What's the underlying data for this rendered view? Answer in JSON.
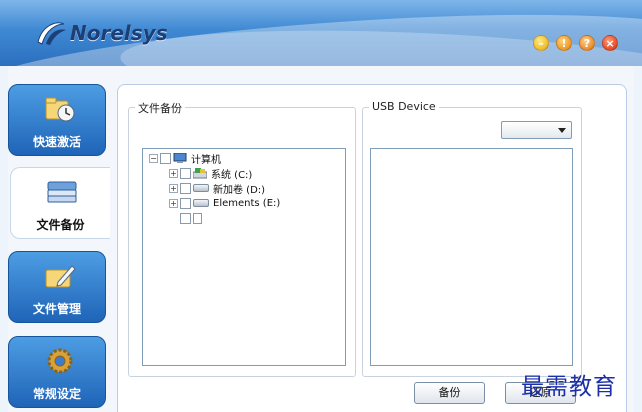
{
  "app": {
    "logo_text": "Norelsys"
  },
  "header_buttons": [
    {
      "name": "minimize",
      "glyph": "–"
    },
    {
      "name": "warning",
      "glyph": "!"
    },
    {
      "name": "help",
      "glyph": "?"
    },
    {
      "name": "close",
      "glyph": "×"
    }
  ],
  "sidebar": {
    "items": [
      {
        "label": "快速激活",
        "icon": "quick-activate-icon",
        "active": false
      },
      {
        "label": "文件备份",
        "icon": "file-backup-icon",
        "active": true
      },
      {
        "label": "文件管理",
        "icon": "file-manage-icon",
        "active": false
      },
      {
        "label": "常规设定",
        "icon": "settings-gear-icon",
        "active": false
      }
    ]
  },
  "backup": {
    "group_title": "文件备份",
    "tree": [
      {
        "label": "计算机",
        "level": 0
      },
      {
        "label": "系统 (C:)",
        "level": 1
      },
      {
        "label": "新加卷 (D:)",
        "level": 1
      },
      {
        "label": "Elements (E:)",
        "level": 1
      },
      {
        "label": "",
        "level": 1
      }
    ]
  },
  "usb": {
    "group_title": "USB Device",
    "selected": ""
  },
  "buttons": {
    "backup": "备份",
    "restore": "还原"
  },
  "watermark": "最需教育",
  "colors": {
    "header": "#3f89d3",
    "sidebar": "#1f64b8",
    "watermark": "#1c2fa8"
  }
}
